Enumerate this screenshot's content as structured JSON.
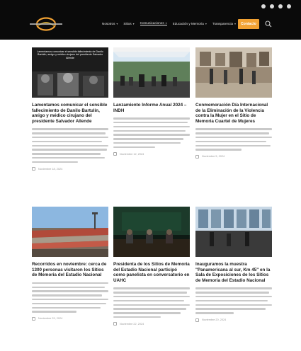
{
  "header": {
    "logo_alt": "Sitios de Memoria",
    "nav": [
      {
        "label": "Nosotros",
        "has_submenu": true,
        "active": false
      },
      {
        "label": "Sitios",
        "has_submenu": true,
        "active": false
      },
      {
        "label": "Comunicaciones",
        "has_submenu": true,
        "active": true
      },
      {
        "label": "Educación y Memoria",
        "has_submenu": true,
        "active": false
      },
      {
        "label": "Transparencia",
        "has_submenu": true,
        "active": false
      }
    ],
    "cta_label": "Contacto",
    "social_icons": [
      "facebook-icon",
      "instagram-icon",
      "x-icon",
      "youtube-icon"
    ],
    "accent": "#f2a233"
  },
  "cards": [
    {
      "title": "Lamentamos comunicar el sensible fallecimiento de Danilo Bartulín, amigo y médico cirujano del presidente Salvador Allende",
      "image_caption": "Lamentamos comunicar el sensible fallecimiento de Danilo Bartulín, amigo y médico cirujano del presidente Salvador Allende",
      "date": "Noviembre 18, 2024"
    },
    {
      "title": "Lanzamiento Informe Anual 2024 – INDH",
      "date": "Noviembre 12, 2024"
    },
    {
      "title": "Conmemoración Día Internacional de la Eliminación de la Violencia contra la Mujer en el Sitio de Memoria Cuartel de Mujeres",
      "date": "Noviembre 5, 2024"
    },
    {
      "title": "Recorridos en noviembre: cerca de 1300 personas visitaron los Sitios de Memoria del Estadio Nacional",
      "date": "Noviembre 29, 2024"
    },
    {
      "title": "Presidenta de los Sitios de Memoria del Estadio Nacional participó como panelista en conversatorio en UAHC",
      "date": "Noviembre 22, 2024"
    },
    {
      "title": "Inauguramos la muestra \"Panamericana al sur, Km 45\" en la Sala de Exposiciones de los Sitios de Memoria del Estadio Nacional",
      "date": "Noviembre 20, 2024"
    }
  ]
}
